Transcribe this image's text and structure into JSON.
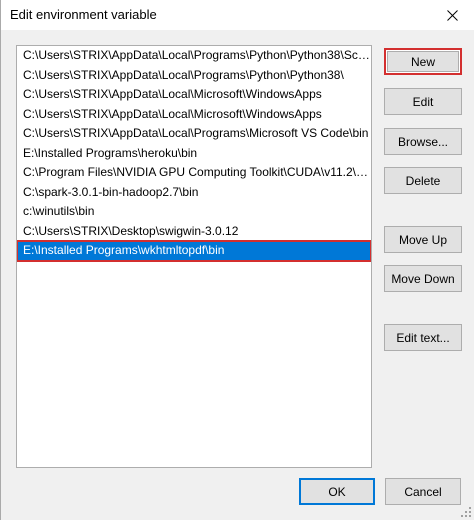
{
  "window": {
    "title": "Edit environment variable"
  },
  "list": {
    "items": [
      "C:\\Users\\STRIX\\AppData\\Local\\Programs\\Python\\Python38\\Scri...",
      "C:\\Users\\STRIX\\AppData\\Local\\Programs\\Python\\Python38\\",
      "C:\\Users\\STRIX\\AppData\\Local\\Microsoft\\WindowsApps",
      "C:\\Users\\STRIX\\AppData\\Local\\Microsoft\\WindowsApps",
      "C:\\Users\\STRIX\\AppData\\Local\\Programs\\Microsoft VS Code\\bin",
      "E:\\Installed Programs\\heroku\\bin",
      "C:\\Program Files\\NVIDIA GPU Computing Toolkit\\CUDA\\v11.2\\e...",
      "C:\\spark-3.0.1-bin-hadoop2.7\\bin",
      "c:\\winutils\\bin",
      "C:\\Users\\STRIX\\Desktop\\swigwin-3.0.12",
      "E:\\Installed Programs\\wkhtmltopdf\\bin"
    ],
    "selected_index": 10
  },
  "buttons": {
    "new": "New",
    "edit": "Edit",
    "browse": "Browse...",
    "delete": "Delete",
    "move_up": "Move Up",
    "move_down": "Move Down",
    "edit_text": "Edit text...",
    "ok": "OK",
    "cancel": "Cancel"
  },
  "colors": {
    "selection": "#0078d7",
    "annotation_red": "#d32f2f"
  }
}
